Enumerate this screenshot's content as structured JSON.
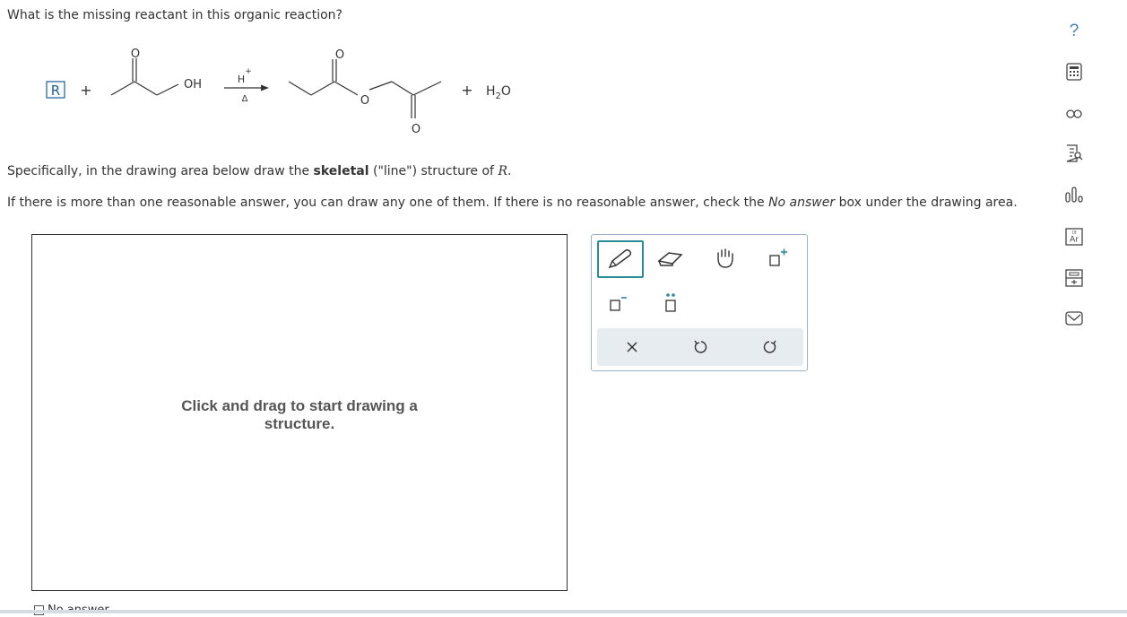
{
  "question": "What is the missing reactant in this organic reaction?",
  "reaction": {
    "unknown_label": "R",
    "plus": "+",
    "acid_oh": "OH",
    "acid_o": "O",
    "catalyst": "H",
    "catalyst_charge": "+",
    "heat": "Δ",
    "product_o_top": "O",
    "product_o_ester": "O",
    "product_o_bottom": "O",
    "byproduct_plus": "+",
    "byproduct_h": "H",
    "byproduct_sub": "2",
    "byproduct_o": "O"
  },
  "instructions": {
    "line1_prefix": "Specifically, in the drawing area below draw the ",
    "line1_bold": "skeletal",
    "line1_mid": " (\"line\") structure of ",
    "line1_var": "R",
    "line1_end": ".",
    "line2_prefix": "If there is more than one reasonable answer, you can draw any one of them. If there is no reasonable answer, check the ",
    "line2_italic": "No answer",
    "line2_suffix": " box under the drawing area."
  },
  "canvas": {
    "hint": "Click and drag to start drawing a structure."
  },
  "toolbox": {
    "tools": [
      "pencil-icon",
      "eraser-icon",
      "hand-icon",
      "add-positive-charge-icon",
      "add-negative-charge-icon",
      "add-lone-pair-icon"
    ],
    "actions": [
      "clear-icon",
      "undo-icon",
      "redo-icon"
    ]
  },
  "sidebar": {
    "icons": [
      "help-icon",
      "calculator-icon",
      "unit-conversion-icon",
      "reference-data-icon",
      "chart-icon",
      "periodic-table-icon",
      "tools-icon",
      "message-icon"
    ],
    "help": "?",
    "periodic_symbol": "Ar",
    "periodic_number": "18"
  },
  "no_answer": {
    "label": "No answer"
  },
  "colors": {
    "accent": "#2a8c9a",
    "r_box": "#1a5e9a",
    "toolbar_bg": "#e6ecf0"
  }
}
